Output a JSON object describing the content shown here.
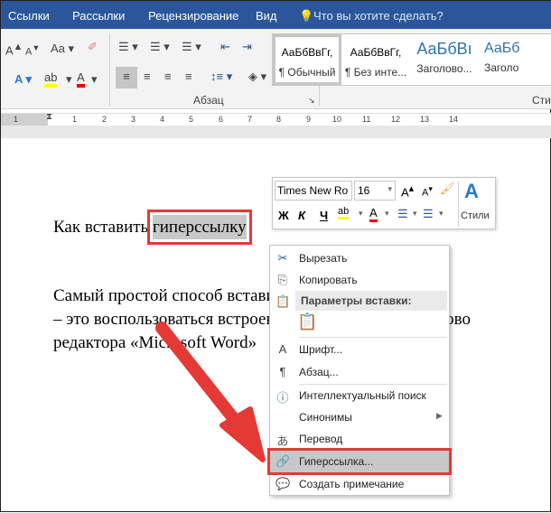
{
  "tabs": [
    "Ссылки",
    "Рассылки",
    "Рецензирование",
    "Вид"
  ],
  "tell_me": "Что вы хотите сделать?",
  "ribbon": {
    "paragraph_group": "Абзац",
    "styles_group": "Стили",
    "styles": [
      {
        "preview": "АаБбВвГг,",
        "name": "¶ Обычный"
      },
      {
        "preview": "АаБбВвГг,",
        "name": "¶ Без инте..."
      },
      {
        "preview": "АаБбВı",
        "name": "Заголово..."
      },
      {
        "preview": "АаБб",
        "name": "Заголо"
      }
    ],
    "font_case": "Aa"
  },
  "ruler": [
    "1",
    "1",
    "2",
    "3",
    "4",
    "5",
    "6",
    "7",
    "8",
    "9",
    "10",
    "11",
    "12",
    "13",
    "14"
  ],
  "document": {
    "heading_before": "Как вставить ",
    "heading_selected": "гиперссылку",
    "para": [
      "Самый простой способ вставить в документ гипер",
      "– это воспользоваться встроенными средствами текстово",
      "редактора «Microsoft Word»"
    ]
  },
  "mini_toolbar": {
    "font": "Times New Ro",
    "size": "16",
    "bold": "Ж",
    "italic": "К",
    "underline": "Ч",
    "styles": "Стили"
  },
  "context_menu": {
    "cut": "Вырезать",
    "copy": "Копировать",
    "paste_options": "Параметры вставки:",
    "font": "Шрифт...",
    "paragraph": "Абзац...",
    "smart_lookup": "Интеллектуальный поиск",
    "synonyms": "Синонимы",
    "translate": "Перевод",
    "hyperlink": "Гиперссылка...",
    "new_comment": "Создать примечание"
  },
  "colors": {
    "accent": "#2b579a",
    "highlight": "#e53935"
  }
}
